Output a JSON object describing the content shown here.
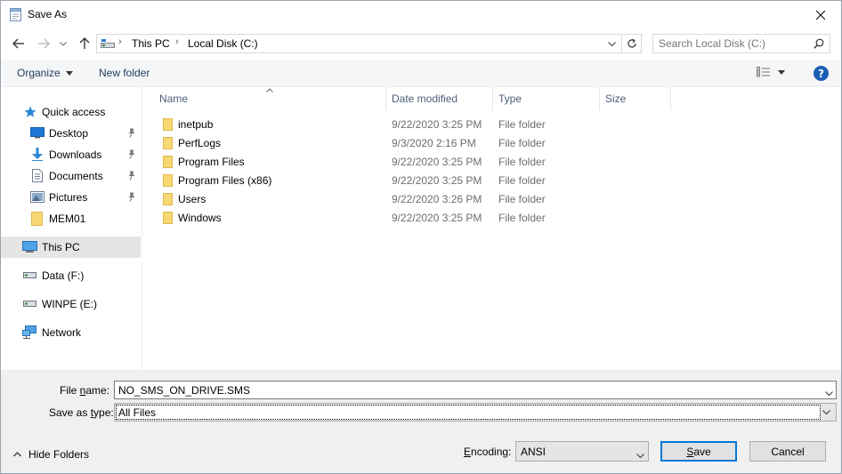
{
  "title": "Save As",
  "address": {
    "segments": [
      "This PC",
      "Local Disk (C:)"
    ]
  },
  "search": {
    "placeholder": "Search Local Disk (C:)"
  },
  "commandbar": {
    "organize": "Organize",
    "new_folder": "New folder"
  },
  "sidebar": {
    "items": [
      {
        "label": "Quick access",
        "icon": "star-icon"
      },
      {
        "label": "Desktop",
        "icon": "desktop-icon",
        "pinned": true
      },
      {
        "label": "Downloads",
        "icon": "download-icon",
        "pinned": true
      },
      {
        "label": "Documents",
        "icon": "documents-icon",
        "pinned": true
      },
      {
        "label": "Pictures",
        "icon": "pictures-icon",
        "pinned": true
      },
      {
        "label": "MEM01",
        "icon": "folder-icon"
      },
      {
        "label": "This PC",
        "icon": "computer-icon",
        "selected": true
      },
      {
        "label": "Data (F:)",
        "icon": "drive-icon"
      },
      {
        "label": "WINPE (E:)",
        "icon": "drive-icon"
      },
      {
        "label": "Network",
        "icon": "network-icon"
      }
    ]
  },
  "columns": [
    "Name",
    "Date modified",
    "Type",
    "Size"
  ],
  "files": [
    {
      "name": "inetpub",
      "date": "9/22/2020 3:25 PM",
      "type": "File folder"
    },
    {
      "name": "PerfLogs",
      "date": "9/3/2020 2:16 PM",
      "type": "File folder"
    },
    {
      "name": "Program Files",
      "date": "9/22/2020 3:25 PM",
      "type": "File folder"
    },
    {
      "name": "Program Files (x86)",
      "date": "9/22/2020 3:25 PM",
      "type": "File folder"
    },
    {
      "name": "Users",
      "date": "9/22/2020 3:26 PM",
      "type": "File folder"
    },
    {
      "name": "Windows",
      "date": "9/22/2020 3:25 PM",
      "type": "File folder"
    }
  ],
  "form": {
    "file_name_label_pre": "File ",
    "file_name_label_key": "n",
    "file_name_label_post": "ame:",
    "file_name_value": "NO_SMS_ON_DRIVE.SMS",
    "save_type_label_pre": "Save as ",
    "save_type_label_key": "t",
    "save_type_label_post": "ype:",
    "save_type_value": "All Files",
    "encoding_label_pre": "",
    "encoding_label_key": "E",
    "encoding_label_post": "ncoding:",
    "encoding_value": "ANSI"
  },
  "hide_folders": "Hide Folders",
  "buttons": {
    "save_key": "S",
    "save_rest": "ave",
    "cancel": "Cancel"
  },
  "colors": {
    "accent": "#0078d7",
    "folder": "#f8d775",
    "selected_bg": "#e5e5e5",
    "panel_bg": "#f0f0f0",
    "link_text": "#1e395b"
  }
}
